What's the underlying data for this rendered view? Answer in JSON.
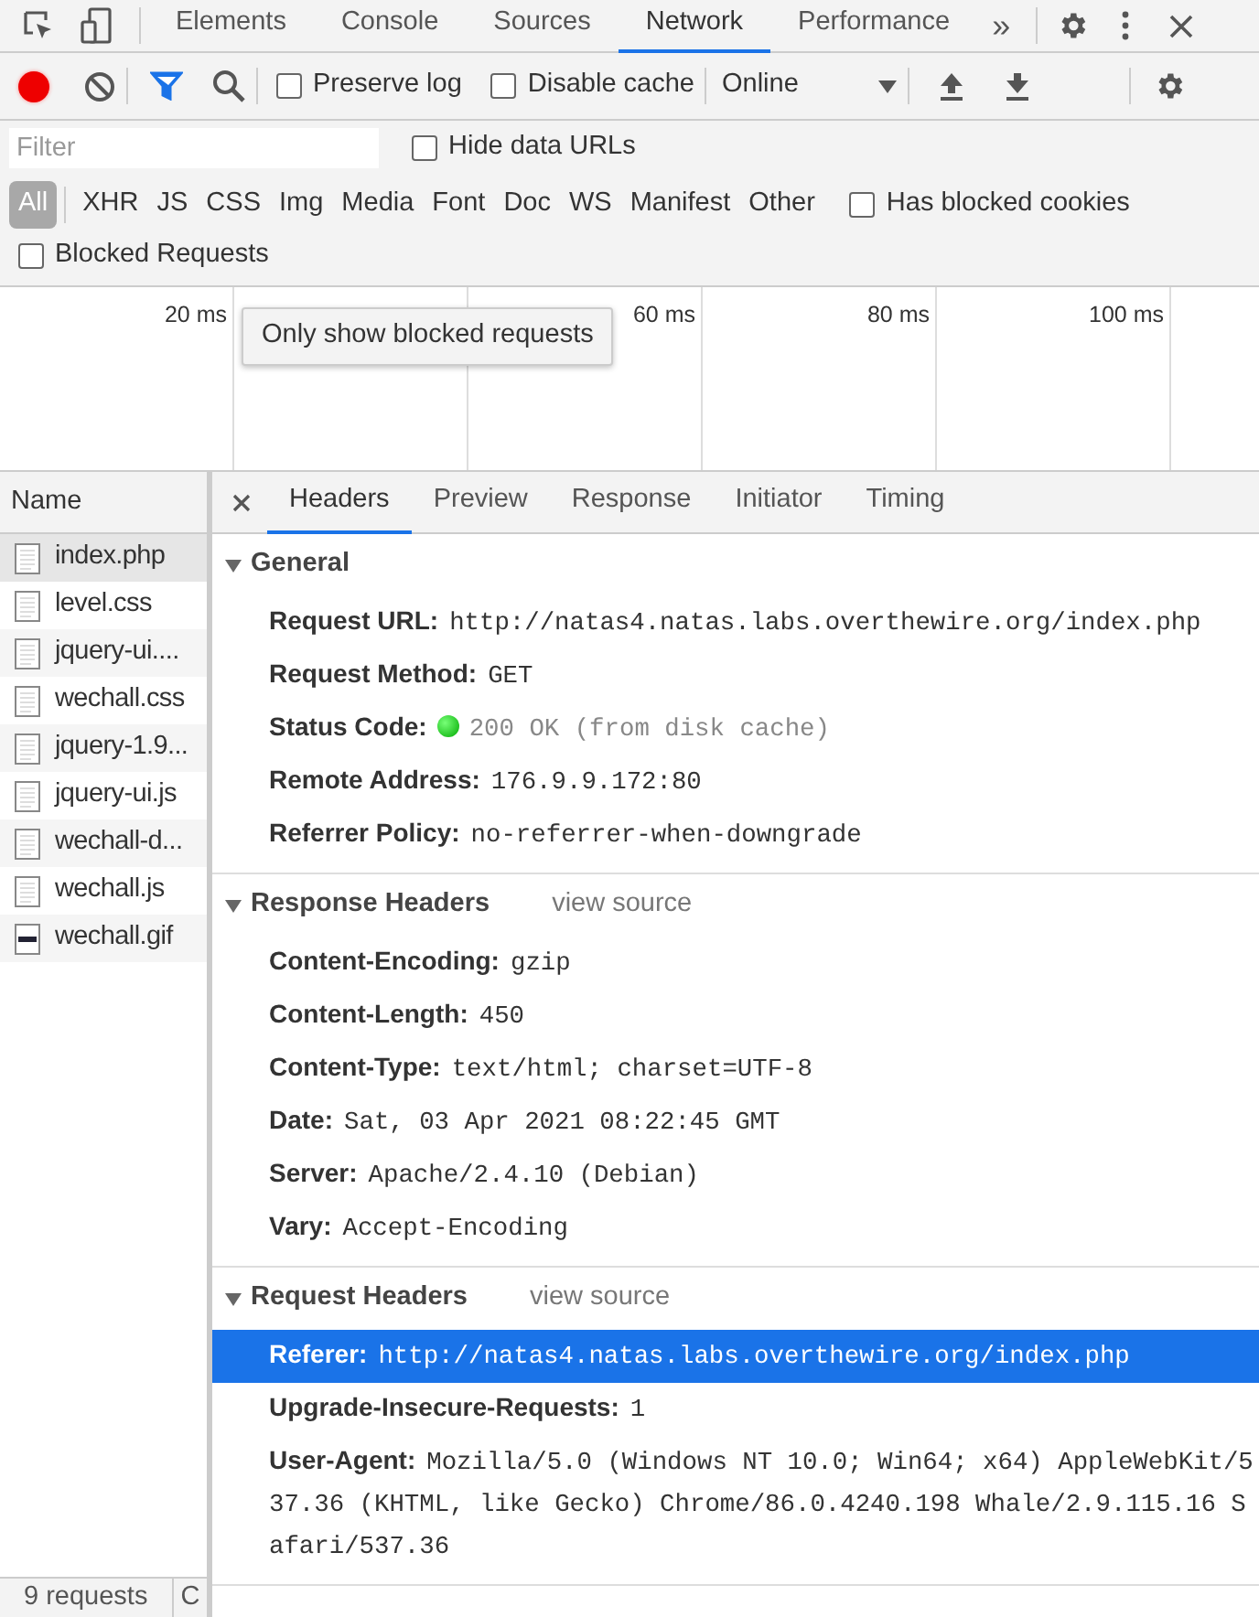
{
  "main_tabs": [
    {
      "label": "Elements",
      "selected": false
    },
    {
      "label": "Console",
      "selected": false
    },
    {
      "label": "Sources",
      "selected": false
    },
    {
      "label": "Network",
      "selected": true
    },
    {
      "label": "Performance",
      "selected": false
    }
  ],
  "more_tabs": "»",
  "toolbar": {
    "recording": true,
    "filter_active": true,
    "preserve_log": {
      "label": "Preserve log",
      "checked": false
    },
    "disable_cache": {
      "label": "Disable cache",
      "checked": false
    },
    "throttling": "Online"
  },
  "filter": {
    "placeholder": "Filter",
    "hide_data_urls": {
      "label": "Hide data URLs",
      "checked": false
    },
    "types": [
      {
        "label": "All",
        "selected": true
      },
      {
        "label": "XHR",
        "selected": false
      },
      {
        "label": "JS",
        "selected": false
      },
      {
        "label": "CSS",
        "selected": false
      },
      {
        "label": "Img",
        "selected": false
      },
      {
        "label": "Media",
        "selected": false
      },
      {
        "label": "Font",
        "selected": false
      },
      {
        "label": "Doc",
        "selected": false
      },
      {
        "label": "WS",
        "selected": false
      },
      {
        "label": "Manifest",
        "selected": false
      },
      {
        "label": "Other",
        "selected": false
      }
    ],
    "has_blocked_cookies": {
      "label": "Has blocked cookies",
      "checked": false
    },
    "blocked_requests": {
      "label": "Blocked Requests",
      "checked": false
    }
  },
  "timeline": {
    "ticks": [
      "20 ms",
      "60 ms",
      "80 ms",
      "100 ms"
    ]
  },
  "tooltip": "Only show blocked requests",
  "requests": {
    "column": "Name",
    "items": [
      {
        "name": "index.php",
        "kind": "doc",
        "selected": true
      },
      {
        "name": "level.css",
        "kind": "doc",
        "selected": false
      },
      {
        "name": "jquery-ui....",
        "kind": "doc",
        "selected": false
      },
      {
        "name": "wechall.css",
        "kind": "doc",
        "selected": false
      },
      {
        "name": "jquery-1.9...",
        "kind": "doc",
        "selected": false
      },
      {
        "name": "jquery-ui.js",
        "kind": "doc",
        "selected": false
      },
      {
        "name": "wechall-d...",
        "kind": "doc",
        "selected": false
      },
      {
        "name": "wechall.js",
        "kind": "doc",
        "selected": false
      },
      {
        "name": "wechall.gif",
        "kind": "image",
        "selected": false
      }
    ]
  },
  "status_bar": [
    "9 requests",
    "C"
  ],
  "detail_tabs": [
    {
      "label": "Headers",
      "selected": true
    },
    {
      "label": "Preview",
      "selected": false
    },
    {
      "label": "Response",
      "selected": false
    },
    {
      "label": "Initiator",
      "selected": false
    },
    {
      "label": "Timing",
      "selected": false
    }
  ],
  "sections": [
    {
      "title": "General",
      "expanded": true,
      "rows": [
        {
          "key": "Request URL:",
          "value": "http://natas4.natas.labs.overthewire.org/index.php",
          "selected": false
        },
        {
          "key": "Request Method:",
          "value": "GET",
          "selected": false
        },
        {
          "key": "Status Code:",
          "value": "200 OK (from disk cache)",
          "kind": "status",
          "selected": false
        },
        {
          "key": "Remote Address:",
          "value": "176.9.9.172:80",
          "selected": false
        },
        {
          "key": "Referrer Policy:",
          "value": "no-referrer-when-downgrade",
          "selected": false
        }
      ]
    },
    {
      "title": "Response Headers",
      "link": "view source",
      "expanded": true,
      "rows": [
        {
          "key": "Content-Encoding:",
          "value": "gzip",
          "selected": false
        },
        {
          "key": "Content-Length:",
          "value": "450",
          "selected": false
        },
        {
          "key": "Content-Type:",
          "value": "text/html; charset=UTF-8",
          "selected": false
        },
        {
          "key": "Date:",
          "value": "Sat, 03 Apr 2021 08:22:45 GMT",
          "selected": false
        },
        {
          "key": "Server:",
          "value": "Apache/2.4.10 (Debian)",
          "selected": false
        },
        {
          "key": "Vary:",
          "value": "Accept-Encoding",
          "selected": false
        }
      ]
    },
    {
      "title": "Request Headers",
      "link": "view source",
      "expanded": true,
      "rows": [
        {
          "key": "Referer:",
          "value": "http://natas4.natas.labs.overthewire.org/index.php",
          "selected": true
        },
        {
          "key": "Upgrade-Insecure-Requests:",
          "value": "1",
          "selected": false
        },
        {
          "key": "User-Agent:",
          "value": "Mozilla/5.0 (Windows NT 10.0; Win64; x64) AppleWebKit/537.36 (KHTML, like Gecko) Chrome/86.0.4240.198 Whale/2.9.115.16 Safari/537.36",
          "selected": false
        }
      ]
    }
  ]
}
